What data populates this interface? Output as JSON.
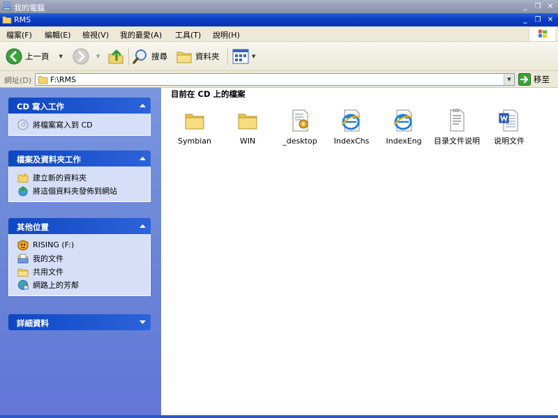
{
  "outer_window": {
    "title": "我的電腦"
  },
  "inner_window": {
    "title": "RMS"
  },
  "window_controls": [
    "minimize",
    "restore",
    "close"
  ],
  "menu": [
    "檔案(F)",
    "編輯(E)",
    "檢視(V)",
    "我的最愛(A)",
    "工具(T)",
    "說明(H)"
  ],
  "toolbar": {
    "back_label": "上一頁",
    "search_label": "搜尋",
    "folders_label": "資料夾"
  },
  "address": {
    "label": "網址(D)",
    "value": "F:\\RMS",
    "go_label": "移至"
  },
  "panels": {
    "cd_tasks": {
      "title": "CD 寫入工作",
      "items": [
        "將檔案寫入到 CD"
      ]
    },
    "file_tasks": {
      "title": "檔案及資料夾工作",
      "items": [
        "建立新的資料夾",
        "將這個資料夾發佈到網站"
      ]
    },
    "other_places": {
      "title": "其他位置",
      "items": [
        "RISING (F:)",
        "我的文件",
        "共用文件",
        "網路上的芳鄰"
      ]
    },
    "details": {
      "title": "詳細資料"
    }
  },
  "content": {
    "heading": "目前在 CD 上的檔案",
    "files": [
      {
        "name": "Symbian",
        "icon": "folder-icon"
      },
      {
        "name": "WIN",
        "icon": "folder-icon"
      },
      {
        "name": "_desktop",
        "icon": "settings-file-icon"
      },
      {
        "name": "IndexChs",
        "icon": "ie-html-icon"
      },
      {
        "name": "IndexEng",
        "icon": "ie-html-icon"
      },
      {
        "name": "目录文件说明",
        "icon": "text-file-icon"
      },
      {
        "name": "说明文件",
        "icon": "word-doc-icon"
      }
    ]
  },
  "colors": {
    "title_blue": "#0b3fc6",
    "side_pane": "#6a86d6",
    "panel_body": "#d6dff7",
    "panel_title": "#215dc6",
    "chrome": "#ece9d8"
  }
}
